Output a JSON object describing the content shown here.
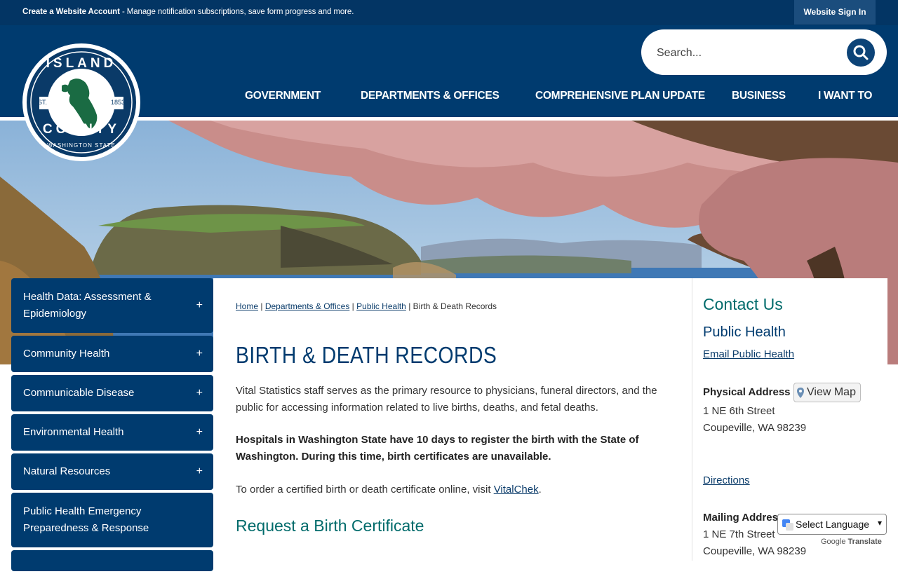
{
  "topbar": {
    "create_account": "Create a Website Account",
    "message": "- Manage notification subscriptions, save form progress and more.",
    "sign_in": "Website Sign In"
  },
  "logo": {
    "top": "ISLAND",
    "bottom": "COUNTY",
    "est_left": "EST.",
    "est_right": "1853",
    "state": "WASHINGTON STATE"
  },
  "search": {
    "placeholder": "Search..."
  },
  "nav": [
    "GOVERNMENT",
    "DEPARTMENTS & OFFICES",
    "COMPREHENSIVE PLAN UPDATE",
    "BUSINESS",
    "I WANT TO"
  ],
  "sidebar": [
    {
      "label": "Health Data: Assessment & Epidemiology",
      "icon": "+"
    },
    {
      "label": "Community Health",
      "icon": "+"
    },
    {
      "label": "Communicable Disease",
      "icon": "+"
    },
    {
      "label": "Environmental Health",
      "icon": "+"
    },
    {
      "label": "Natural Resources",
      "icon": "+"
    },
    {
      "label": "Public Health Emergency Preparedness & Response",
      "icon": ""
    }
  ],
  "breadcrumb": {
    "home": "Home",
    "departments": "Departments & Offices",
    "public_health": "Public Health",
    "current": "Birth & Death Records",
    "sep": "|"
  },
  "main": {
    "title": "BIRTH & DEATH RECORDS",
    "p1": "Vital Statistics staff serves as the primary resource to physicians, funeral directors, and the public for accessing information related to live births, deaths, and fetal deaths.",
    "p2": "Hospitals in Washington State have 10 days to register the birth with the State of Washington. During this time, birth certificates are unavailable.",
    "p3_prefix": "To order a certified birth or death certificate online, visit ",
    "p3_link": "VitalChek",
    "p3_suffix": ".",
    "h2": "Request a Birth Certificate"
  },
  "contact": {
    "title": "Contact Us",
    "dept": "Public Health",
    "email": "Email Public Health",
    "physical_label": "Physical Address",
    "view_map": "View Map",
    "phys_line1": "1 NE 6th Street",
    "phys_line2": "Coupeville, WA 98239",
    "directions": "Directions",
    "mailing_label": "Mailing Address",
    "mail_line1": "1 NE 7th Street",
    "mail_line2": "Coupeville, WA 98239"
  },
  "translate": {
    "select": "Select Language",
    "powered": "Google",
    "label": "Translate"
  }
}
